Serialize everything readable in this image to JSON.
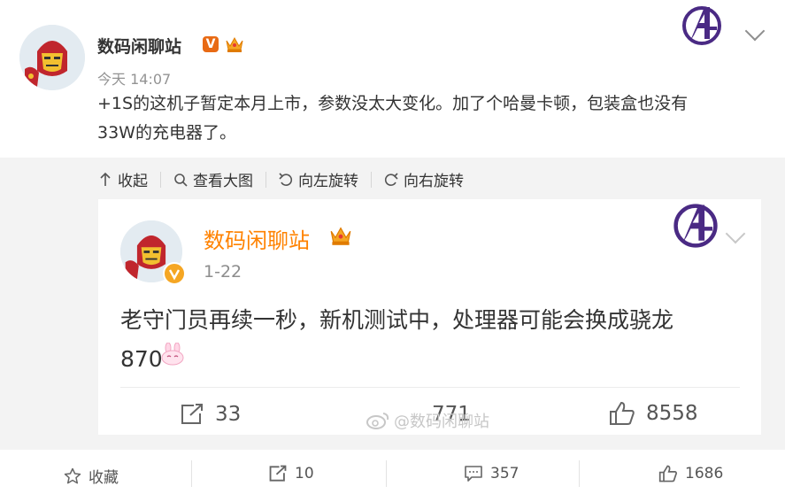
{
  "post": {
    "username": "数码闲聊站",
    "verified_badge": "V",
    "time": "今天 14:07",
    "text": "+1S的这机子暂定本月上市，参数没太大变化。加了个哈曼卡顿，包装盒也没有\n33W的充电器了。"
  },
  "toolbar": {
    "collapse": "收起",
    "view_large": "查看大图",
    "rotate_left": "向左旋转",
    "rotate_right": "向右旋转"
  },
  "quoted": {
    "username": "数码闲聊站",
    "time": "1-22",
    "text": "老守门员再续一秒，新机测试中，处理器可能会换成骁龙\n870",
    "reposts": "33",
    "comments": "771",
    "likes": "8558",
    "watermark": "@数码闲聊站"
  },
  "bottom": {
    "favorite": "收藏",
    "reposts": "10",
    "comments": "357",
    "likes": "1686"
  },
  "colors": {
    "accent_orange": "#ff8200",
    "verified_orange": "#e86a14",
    "avengers_purple": "#4a2a84"
  }
}
